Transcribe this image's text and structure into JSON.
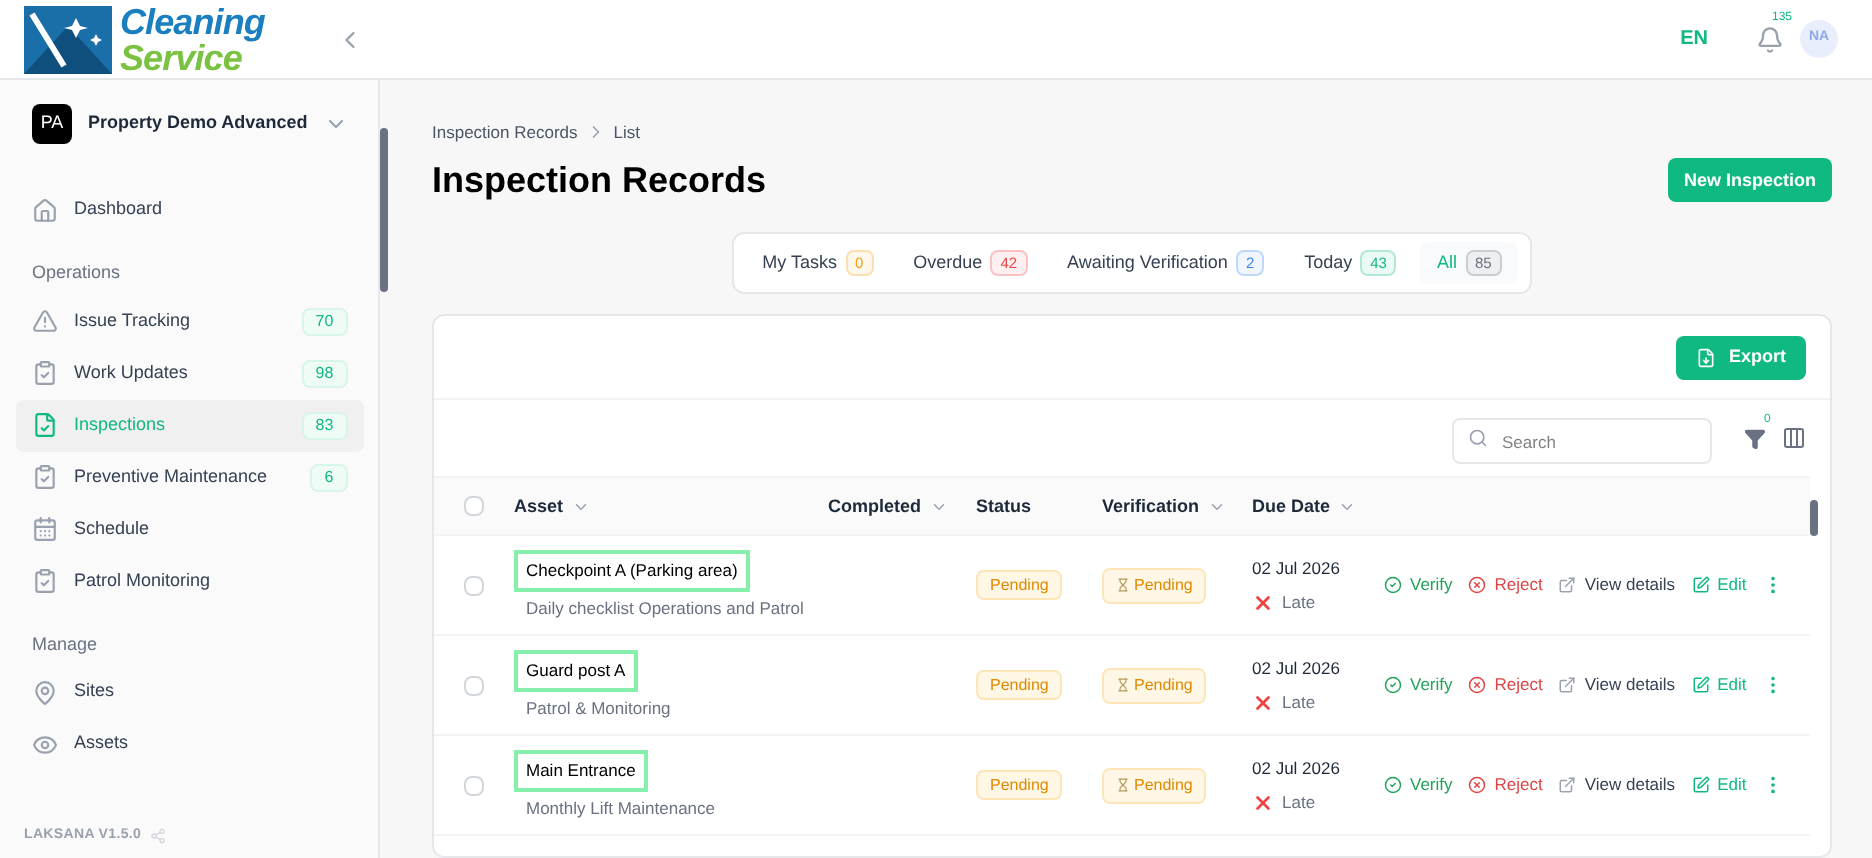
{
  "brand": {
    "line1": "Cleaning",
    "line2": "Service"
  },
  "header": {
    "language": {
      "label": "EN",
      "selected": true
    },
    "notifications": "135",
    "avatar": "NA"
  },
  "property": {
    "initials": "PA",
    "name": "Property Demo Advanced"
  },
  "sidebar": {
    "sections": [
      {
        "items": [
          {
            "label": "Dashboard",
            "selected": false
          }
        ]
      },
      {
        "title": "Operations",
        "items": [
          {
            "label": "Issue Tracking",
            "count": "70",
            "selected": false
          },
          {
            "label": "Work Updates",
            "count": "98",
            "selected": false
          },
          {
            "label": "Inspections",
            "count": "83",
            "selected": true
          },
          {
            "label": "Preventive Maintenance",
            "count": "6",
            "selected": false
          },
          {
            "label": "Schedule",
            "selected": false
          },
          {
            "label": "Patrol Monitoring",
            "selected": false
          }
        ]
      },
      {
        "title": "Manage",
        "items": [
          {
            "label": "Sites",
            "selected": false
          },
          {
            "label": "Assets",
            "selected": false
          }
        ]
      }
    ],
    "version": "LAKSANA V1.5.0"
  },
  "breadcrumb": [
    "Inspection Records",
    "List"
  ],
  "page_title": "Inspection Records",
  "new_button": "New Inspection",
  "filter_tabs": [
    {
      "label": "My Tasks",
      "count": "0",
      "color": "#f59e0b",
      "selected": false
    },
    {
      "label": "Overdue",
      "count": "42",
      "color": "#ef4444",
      "selected": false
    },
    {
      "label": "Awaiting Verification",
      "count": "2",
      "color": "#3b82f6",
      "selected": false
    },
    {
      "label": "Today",
      "count": "43",
      "color": "#10b981",
      "selected": false
    },
    {
      "label": "All",
      "count": "85",
      "color": "#6b7280",
      "selected": true
    }
  ],
  "export_button": "Export",
  "search": {
    "placeholder": "Search"
  },
  "filter_count": "0",
  "table": {
    "select_all_checked": false,
    "columns": [
      {
        "label": "Asset",
        "sortable": true
      },
      {
        "label": "Completed",
        "sortable": true
      },
      {
        "label": "Status",
        "sortable": false
      },
      {
        "label": "Verification",
        "sortable": true
      },
      {
        "label": "Due Date",
        "sortable": true
      }
    ],
    "rows": [
      {
        "asset": "Checkpoint A (Parking area)",
        "subtitle": "Daily checklist Operations and Patrol",
        "highlighted": true,
        "checked": false,
        "status": "Pending",
        "verification": "Pending",
        "due_date": "02 Jul 2026",
        "due_state": "Late",
        "actions": [
          "Verify",
          "Reject",
          "View details",
          "Edit"
        ]
      },
      {
        "asset": "Guard post A",
        "subtitle": "Patrol & Monitoring",
        "highlighted": true,
        "checked": false,
        "status": "Pending",
        "verification": "Pending",
        "due_date": "02 Jul 2026",
        "due_state": "Late",
        "actions": [
          "Verify",
          "Reject",
          "View details",
          "Edit"
        ]
      },
      {
        "asset": "Main Entrance",
        "subtitle": "Monthly Lift Maintenance",
        "highlighted": true,
        "checked": false,
        "status": "Pending",
        "verification": "Pending",
        "due_date": "02 Jul 2026",
        "due_state": "Late",
        "actions": [
          "Verify",
          "Reject",
          "View details",
          "Edit"
        ]
      }
    ]
  }
}
